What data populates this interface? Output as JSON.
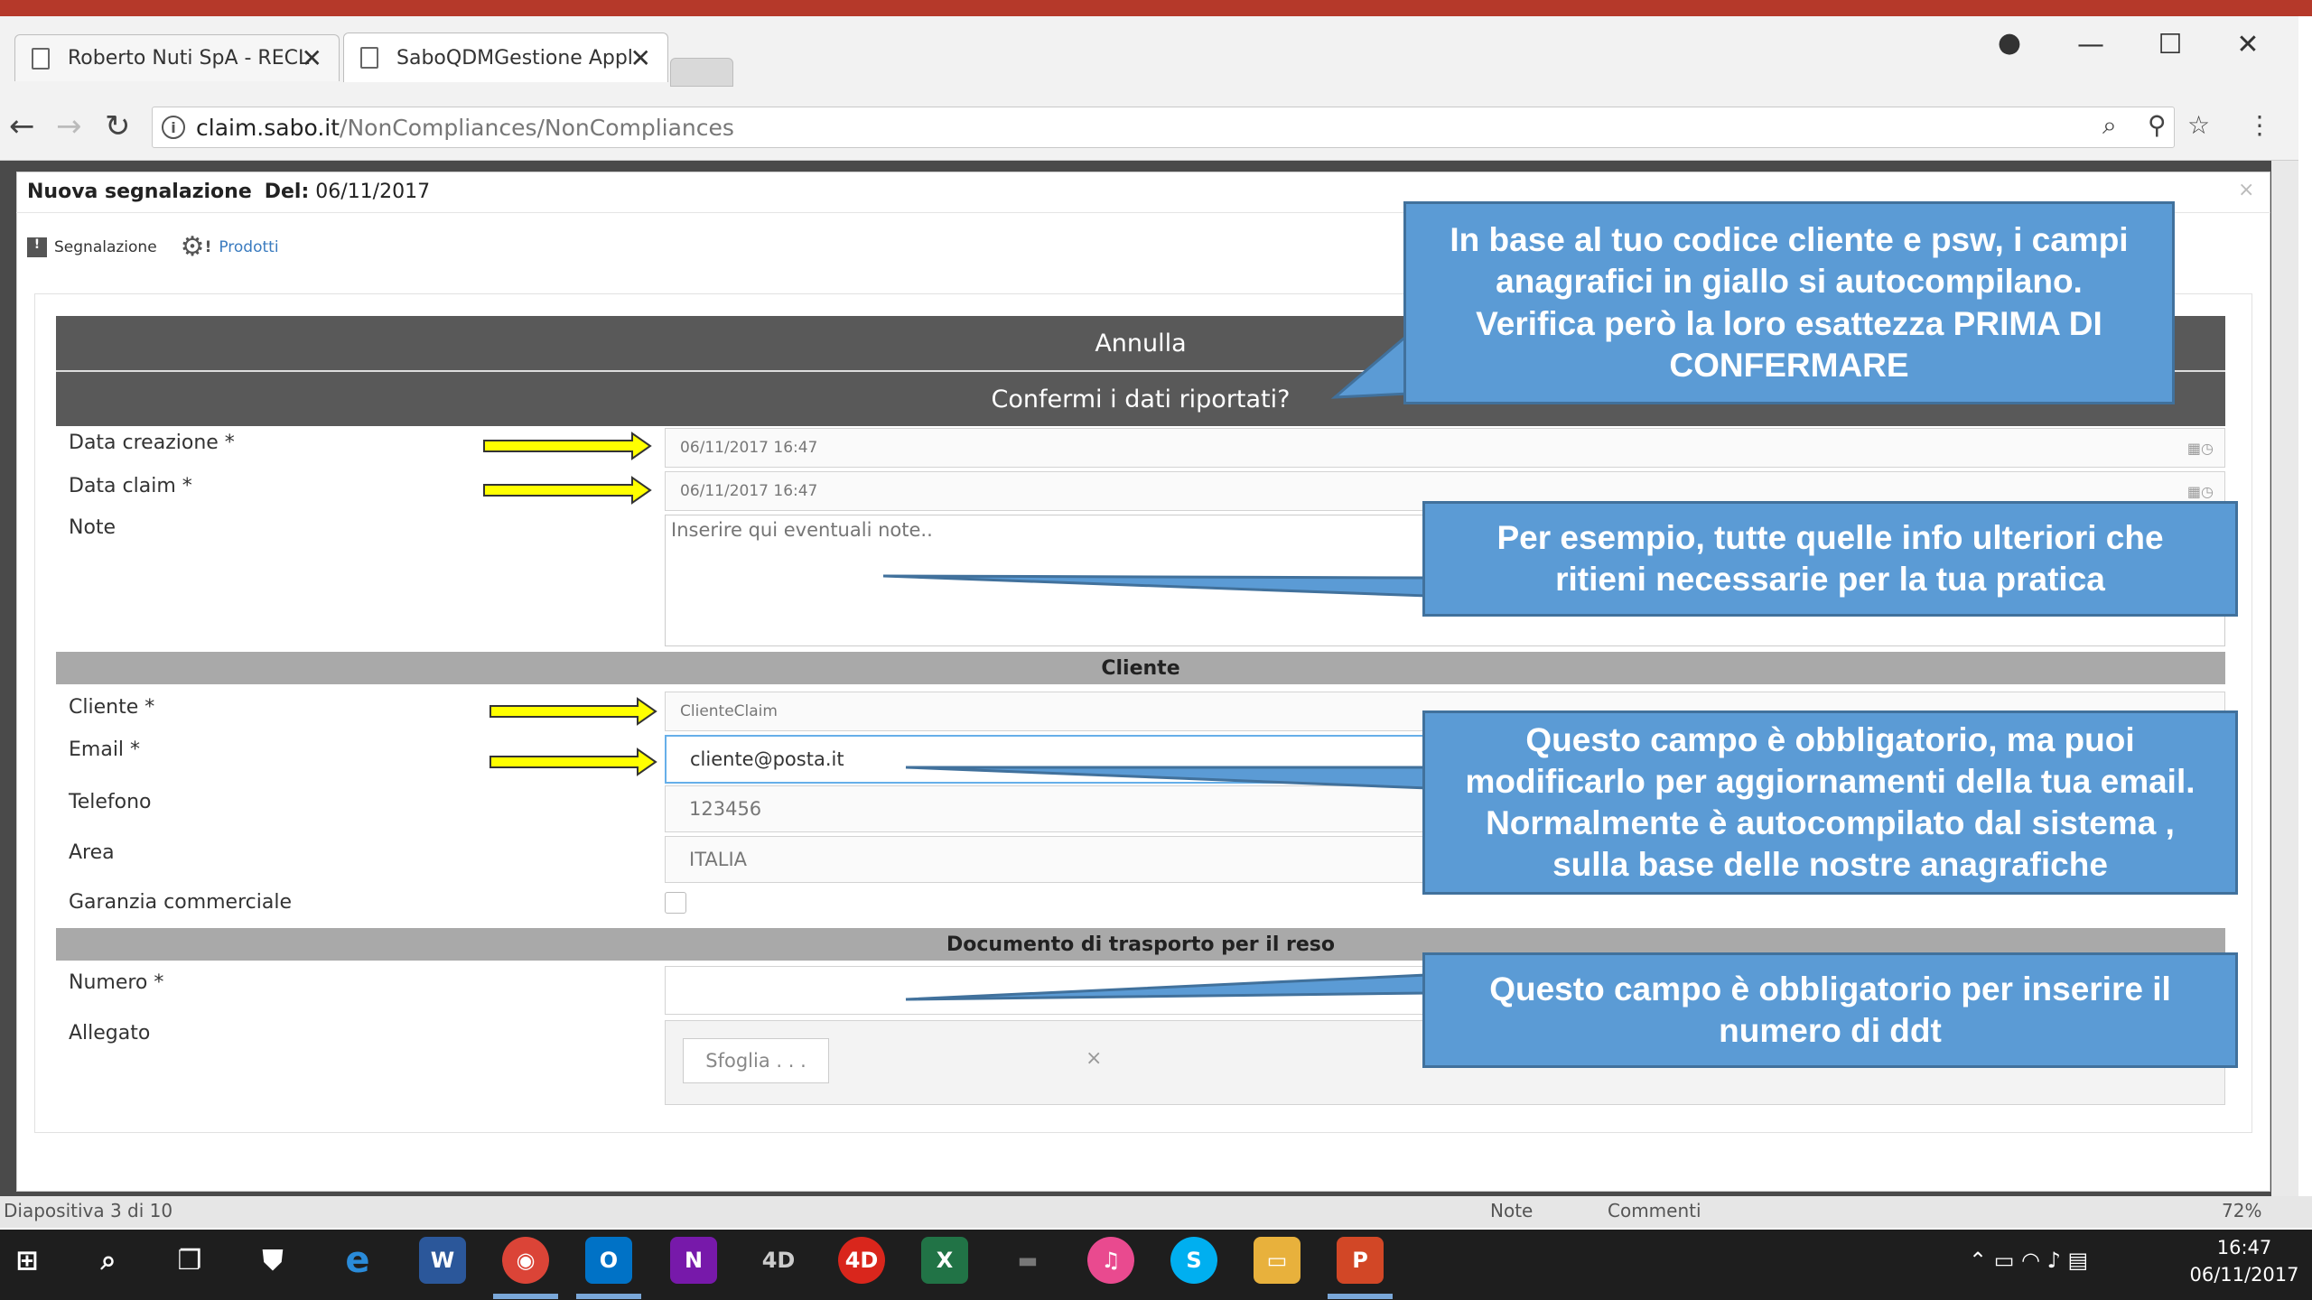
{
  "browser": {
    "tabs": [
      {
        "title": "Roberto Nuti SpA - RECL",
        "active": false
      },
      {
        "title": "SaboQDMGestione Appl",
        "active": true
      }
    ],
    "url_host": "claim.sabo.it",
    "url_path": "/NonCompliances/NonCompliances"
  },
  "modal": {
    "title": "Nuova segnalazione",
    "date_label": "Del:",
    "date_value": "06/11/2017",
    "close": "×",
    "tabs": [
      "Segnalazione",
      "Prodotti"
    ]
  },
  "form": {
    "cancel_label": "Annulla",
    "confirm_label": "Confermi i dati riportati?",
    "fields": {
      "data_creazione": {
        "label": "Data creazione *",
        "value": "06/11/2017 16:47"
      },
      "data_claim": {
        "label": "Data claim *",
        "value": "06/11/2017 16:47"
      },
      "note": {
        "label": "Note",
        "placeholder": "Inserire qui eventuali note.."
      },
      "cliente": {
        "label": "Cliente *",
        "value": "ClienteClaim"
      },
      "email": {
        "label": "Email *",
        "value": "cliente@posta.it"
      },
      "telefono": {
        "label": "Telefono",
        "value": "123456"
      },
      "area": {
        "label": "Area",
        "value": "ITALIA"
      },
      "garanzia": {
        "label": "Garanzia commerciale",
        "checked": false
      },
      "numero": {
        "label": "Numero *",
        "value": ""
      },
      "allegato": {
        "label": "Allegato",
        "browse_label": "Sfoglia . . .",
        "clear": "×"
      }
    },
    "section_cliente": "Cliente",
    "section_ddt": "Documento di trasporto per il reso"
  },
  "callouts": {
    "c1": [
      "In base al tuo codice cliente e psw, i campi",
      "anagrafici in giallo si autocompilano.",
      "Verifica però la loro esattezza PRIMA DI",
      "CONFERMARE"
    ],
    "c2": [
      "Per esempio, tutte quelle info ulteriori che",
      "ritieni necessarie per la tua pratica"
    ],
    "c3": [
      "Questo campo è obbligatorio, ma puoi",
      "modificarlo per aggiornamenti della tua email.",
      "Normalmente è autocompilato dal sistema ,",
      "sulla base delle nostre anagrafiche"
    ],
    "c4": [
      "Questo campo è obbligatorio per inserire il",
      "numero di ddt"
    ]
  },
  "ppt_status": {
    "slide": "Diapositiva 3 di 10",
    "notes": "Note",
    "comments": "Commenti",
    "zoom": "72%"
  },
  "taskbar": {
    "time": "16:47",
    "date": "06/11/2017"
  },
  "colors": {
    "callout_fill": "#5b9bd5",
    "callout_border": "#41719c",
    "arrow_fill": "#ffff00",
    "dark_bar": "#595959",
    "section_bar": "#a9a9a9"
  }
}
